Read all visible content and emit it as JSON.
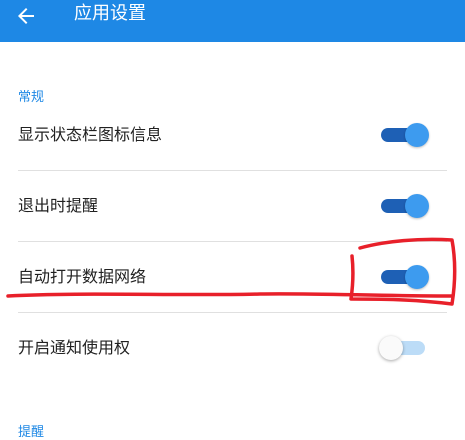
{
  "app_bar": {
    "title": "应用设置",
    "back_icon": "arrow-left-icon",
    "background": "#1e88e5"
  },
  "sections": [
    {
      "header": "常规",
      "items": [
        {
          "label": "显示状态栏图标信息",
          "enabled": true
        },
        {
          "label": "退出时提醒",
          "enabled": true
        },
        {
          "label": "自动打开数据网络",
          "enabled": true
        },
        {
          "label": "开启通知使用权",
          "enabled": false
        }
      ]
    },
    {
      "header": "提醒",
      "items": []
    }
  ],
  "colors": {
    "accent": "#1e88e5",
    "switch_track_on": "#1e60b5",
    "switch_thumb_on": "#3d9bef",
    "annotation": "#e8202a"
  }
}
